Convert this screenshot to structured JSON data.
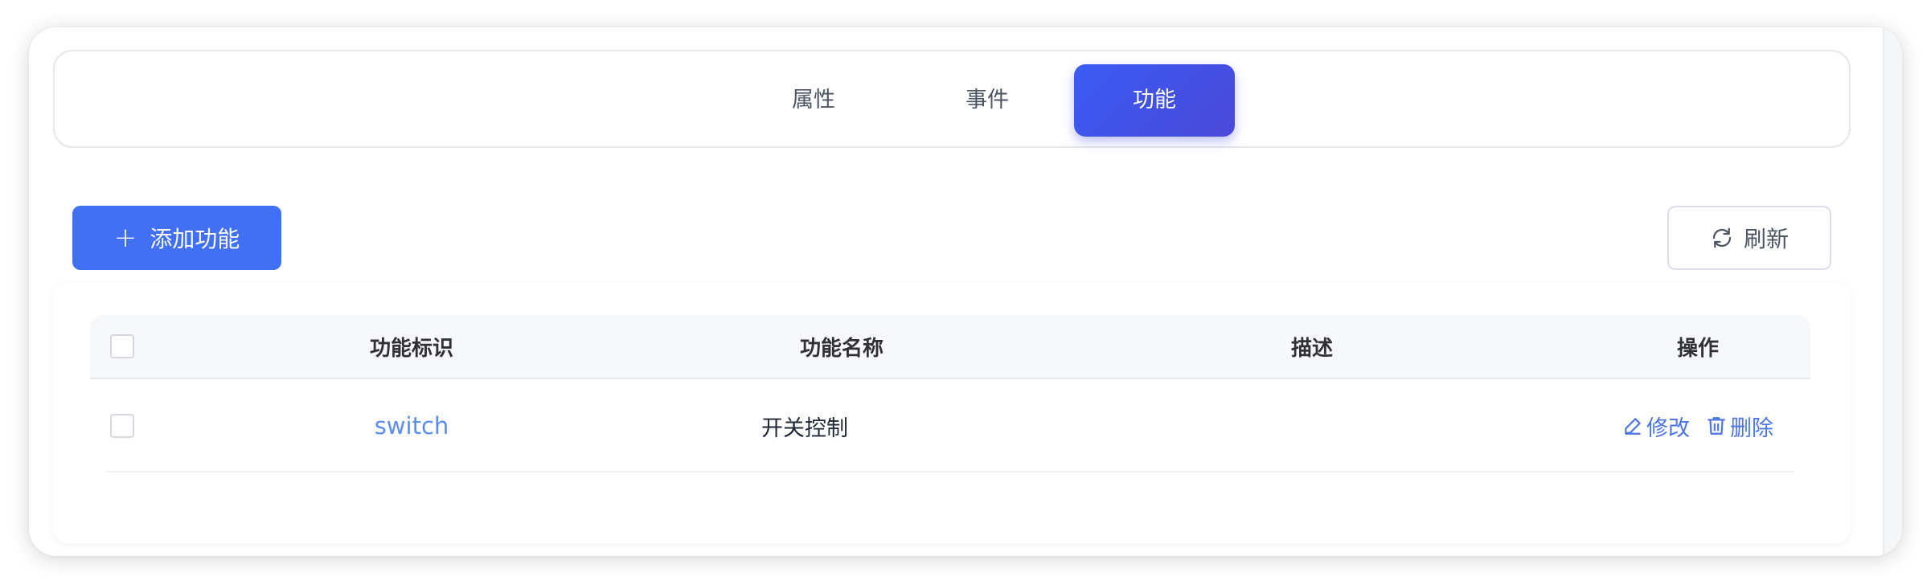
{
  "tabs": [
    {
      "label": "属性",
      "active": false
    },
    {
      "label": "事件",
      "active": false
    },
    {
      "label": "功能",
      "active": true
    }
  ],
  "toolbar": {
    "add_label": "添加功能",
    "refresh_label": "刷新"
  },
  "table": {
    "headers": {
      "id": "功能标识",
      "name": "功能名称",
      "desc": "描述",
      "ops": "操作"
    },
    "rows": [
      {
        "id": "switch",
        "name": "开关控制",
        "desc": "",
        "edit": "修改",
        "delete": "删除"
      }
    ]
  },
  "colors": {
    "accent": "#4270f4",
    "active_tab": "#3b5cf5",
    "link": "#5b8def"
  },
  "icons": {
    "add": "plus-icon",
    "refresh": "refresh-icon",
    "edit": "edit-icon",
    "delete": "trash-icon"
  }
}
